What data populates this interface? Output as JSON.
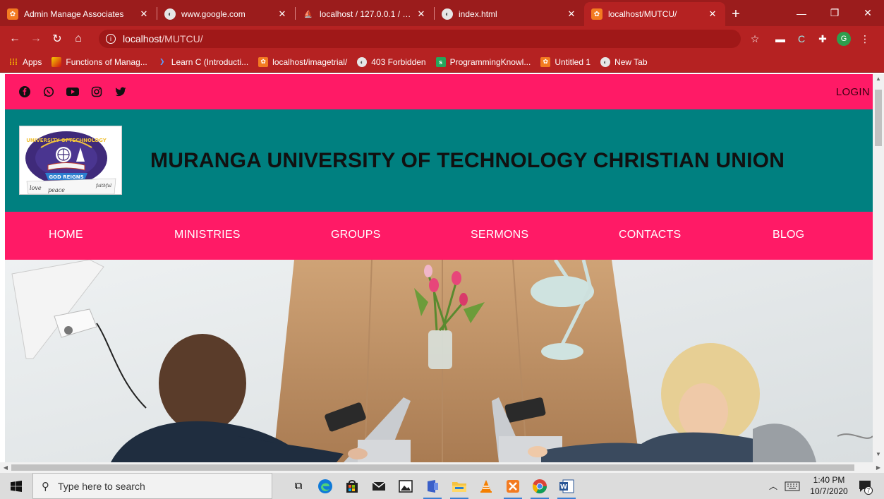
{
  "browser": {
    "tabs": [
      {
        "title": "Admin Manage Associates",
        "icon": "xampp-icon",
        "active": false
      },
      {
        "title": "www.google.com",
        "icon": "globe-icon",
        "active": false
      },
      {
        "title": "localhost / 127.0.0.1 / syste",
        "icon": "phpmyadmin-icon",
        "active": false
      },
      {
        "title": "index.html",
        "icon": "globe-icon",
        "active": false
      },
      {
        "title": "localhost/MUTCU/",
        "icon": "xampp-icon",
        "active": true
      }
    ],
    "new_tab_label": "+",
    "address": {
      "host": "localhost",
      "path": "/MUTCU/"
    },
    "profile_initial": "G",
    "bookmarks": [
      {
        "label": "Apps",
        "icon": "apps-grid-icon"
      },
      {
        "label": "Functions of Manag...",
        "icon": "mark-icon"
      },
      {
        "label": "Learn C (Introducti...",
        "icon": "c-icon"
      },
      {
        "label": "localhost/imagetrial/",
        "icon": "xampp-icon"
      },
      {
        "label": "403 Forbidden",
        "icon": "globe-icon"
      },
      {
        "label": "ProgrammingKnowl...",
        "icon": "s-icon"
      },
      {
        "label": "Untitled 1",
        "icon": "xampp-icon"
      },
      {
        "label": "New Tab",
        "icon": "globe-icon"
      }
    ]
  },
  "site": {
    "top_bar": {
      "social": [
        "facebook-icon",
        "whatsapp-icon",
        "youtube-icon",
        "instagram-icon",
        "twitter-icon"
      ],
      "login_label": "LOGIN"
    },
    "brand_title": "MURANGA UNIVERSITY OF TECHNOLOGY CHRISTIAN UNION",
    "logo": {
      "ring_text": "UNIVERSITY OFTECHNOLOGY",
      "banner_text": "GOD REIGNS",
      "footer_words": [
        "love",
        "peace",
        "faithful"
      ]
    },
    "nav": [
      "HOME",
      "MINISTRIES",
      "GROUPS",
      "SERMONS",
      "CONTACTS",
      "BLOG"
    ]
  },
  "taskbar": {
    "search_placeholder": "Type here to search",
    "time": "1:40 PM",
    "date": "10/7/2020",
    "notification_count": "7"
  },
  "colors": {
    "chrome_dark": "#9b1c1c",
    "chrome": "#b52222",
    "site_pink": "#ff1a66",
    "site_teal": "#008080"
  }
}
